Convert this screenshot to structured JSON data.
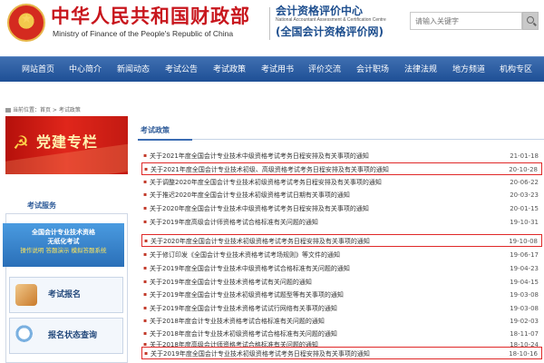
{
  "header": {
    "ministry_name": "中华人民共和国财政部",
    "ministry_english": "Ministry of Finance of the People's Republic of China",
    "center_title": "会计资格评价中心",
    "center_english": "National Accountant Assessment & Certification Centre",
    "center_subtitle": "(全国会计资格评价网)",
    "search_placeholder": "请输入关键字"
  },
  "nav": {
    "items": [
      "网站首页",
      "中心简介",
      "新闻动态",
      "考试公告",
      "考试政策",
      "考试用书",
      "评价交流",
      "会计职场",
      "法律法规",
      "地方频道",
      "机构专区"
    ]
  },
  "breadcrumb": "当前位置：首页 > 考试政策",
  "sidebar": {
    "party_banner": "党建专栏",
    "services_title": "考试服务",
    "promo": {
      "line1": "全国会计专业技术资格",
      "line2": "无纸化考试",
      "line3": "操作说明 答题演示 模拟答题系统"
    },
    "items": [
      {
        "label": "考试报名",
        "icon": "pencil-icon"
      },
      {
        "label": "报名状态查询",
        "icon": "magnifier-icon"
      }
    ]
  },
  "list": {
    "tab_label": "考试政策",
    "rows": [
      {
        "title": "关于2021年度全国会计专业技术中级资格考试考务日程安排及有关事项的通知",
        "date": "21-01-18",
        "highlight": false
      },
      {
        "title": "关于2021年度全国会计专业技术初级、高级资格考试考务日程安排及有关事项的通知",
        "date": "20-10-28",
        "highlight": true
      },
      {
        "title": "关于调整2020年度全国会计专业技术初级资格考试考务日程安排及有关事项的通知",
        "date": "20-06-22",
        "highlight": false
      },
      {
        "title": "关于推迟2020年度全国会计专业技术初级资格考试日期有关事项的通知",
        "date": "20-03-23",
        "highlight": false
      },
      {
        "title": "关于2020年度全国会计专业技术中级资格考试考务日程安排及有关事项的通知",
        "date": "20-01-15",
        "highlight": false
      },
      {
        "title": "关于2019年度高级会计师资格考试合格标准有关问题的通知",
        "date": "19-10-31",
        "highlight": false
      },
      {
        "title": "关于2020年度全国会计专业技术初级资格考试考务日程安排及有关事项的通知",
        "date": "19-10-08",
        "highlight": true
      },
      {
        "title": "关于修订印发《全国会计专业技术资格考试考场规则》等文件的通知",
        "date": "19-06-17",
        "highlight": false
      },
      {
        "title": "关于2019年度全国会计专业技术中级资格考试合格标准有关问题的通知",
        "date": "19-04-23",
        "highlight": false
      },
      {
        "title": "关于2019年度全国会计专业技术资格考试有关问题的通知",
        "date": "19-04-15",
        "highlight": false
      },
      {
        "title": "关于2019年度全国会计专业技术初级资格考试题型等有关事项的通知",
        "date": "19-03-08",
        "highlight": false
      },
      {
        "title": "关于2019年度全国会计专业技术资格考试试行网络有关事项的通知",
        "date": "19-03-08",
        "highlight": false
      },
      {
        "title": "关于2018年度会计专业技术资格考试合格标准有关问题的通知",
        "date": "19-02-03",
        "highlight": false
      },
      {
        "title": "关于2018年度会计专业技术初级资格考试合格标准有关问题的通知",
        "date": "18-11-07",
        "highlight": false
      },
      {
        "title": "关于2018年度高级会计师资格考试合格标准有关问题的通知",
        "date": "18-10-24",
        "highlight": false
      },
      {
        "title": "关于2019年度全国会计专业技术初级资格考试考务日程安排及有关事项的通知",
        "date": "18-10-16",
        "highlight": true
      }
    ]
  },
  "colors": {
    "brand_red": "#c8161d",
    "nav_blue": "#1e4f96",
    "highlight_border": "#e02828"
  }
}
